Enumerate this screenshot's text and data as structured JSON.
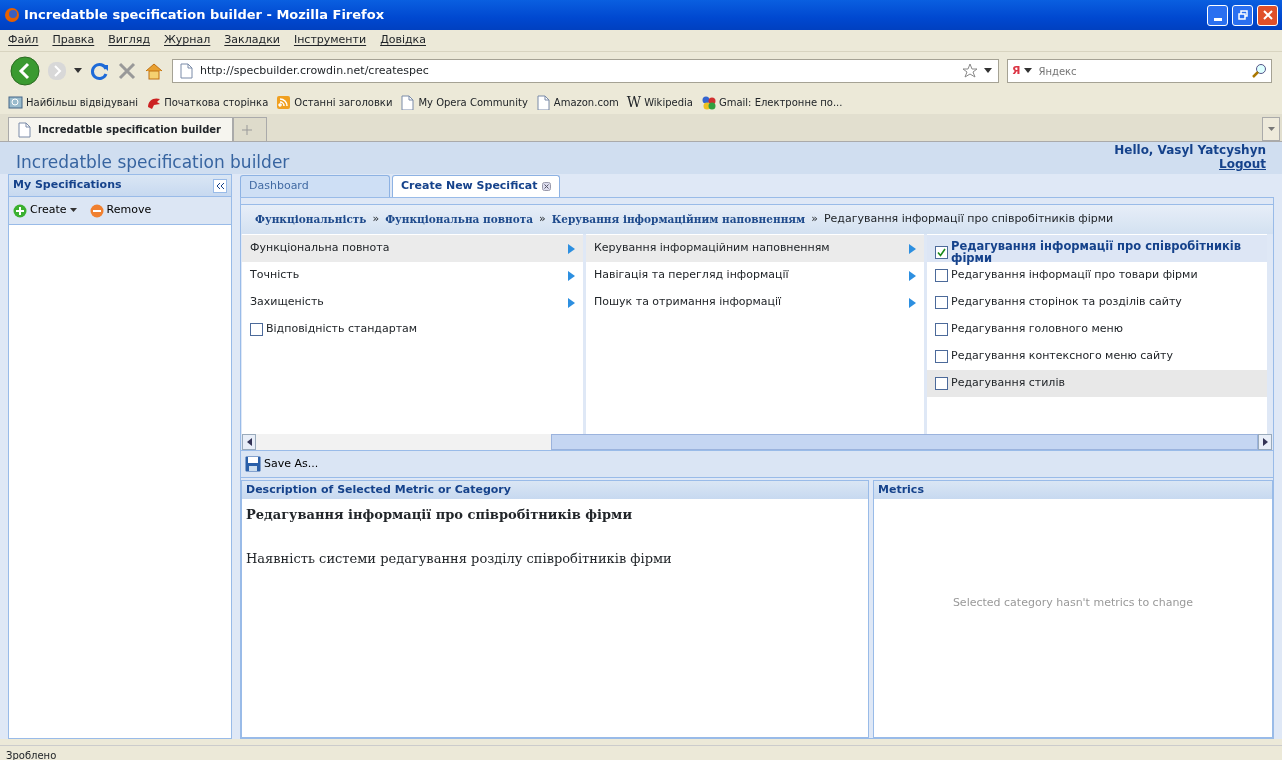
{
  "window": {
    "title": "Incredatble specification builder - Mozilla Firefox"
  },
  "menu": [
    "Файл",
    "Правка",
    "Вигляд",
    "Журнал",
    "Закладки",
    "Інструменти",
    "Довідка"
  ],
  "toolbar": {
    "url": "http://specbuilder.crowdin.net/createspec",
    "search_engine": "Я",
    "search_placeholder": "Яндекс"
  },
  "bookmarks": [
    {
      "label": "Найбільш відвідувані",
      "kind": "search"
    },
    {
      "label": "Початкова сторінка",
      "kind": "bird"
    },
    {
      "label": "Останні заголовки",
      "kind": "rss"
    },
    {
      "label": "My Opera Community",
      "kind": "page"
    },
    {
      "label": "Amazon.com",
      "kind": "page"
    },
    {
      "label": "Wikipedia",
      "kind": "wiki",
      "glyph": "W"
    },
    {
      "label": "Gmail: Електронне по...",
      "kind": "google"
    }
  ],
  "browser_tabs": [
    {
      "label": "Incredatble specification builder",
      "selected": true
    }
  ],
  "app": {
    "title": "Incredatble specification builder",
    "greeting": "Hello, Vasyl Yatcyshyn",
    "logout": "Logout"
  },
  "sidebar": {
    "title": "My Specifications",
    "actions": [
      {
        "label": "Create",
        "kind": "create"
      },
      {
        "label": "Remove",
        "kind": "remove"
      }
    ]
  },
  "tabs": [
    {
      "label": "Dashboard",
      "selected": false,
      "closable": false
    },
    {
      "label": "Create New Specificat",
      "selected": true,
      "closable": true
    }
  ],
  "breadcrumb": {
    "separator": "»",
    "links": [
      "Функціональність",
      "Функціональна повнота",
      "Керування інформаційним наповненням"
    ],
    "current": "Редагування інформації про співробітників фірми"
  },
  "columns": [
    {
      "items": [
        {
          "label": "Функціональна повнота",
          "kind": "branch",
          "selected": true
        },
        {
          "label": "Точність",
          "kind": "branch",
          "selected": false
        },
        {
          "label": "Захищеність",
          "kind": "branch",
          "selected": false
        },
        {
          "label": "Відповідність стандартам",
          "kind": "leaf",
          "checked": false,
          "selected": false
        }
      ]
    },
    {
      "items": [
        {
          "label": "Керування інформаційним наповненням",
          "kind": "branch",
          "selected": true
        },
        {
          "label": "Навігація та перегляд інформації",
          "kind": "branch",
          "selected": false
        },
        {
          "label": "Пошук та отримання інформації",
          "kind": "branch",
          "selected": false
        }
      ]
    },
    {
      "items": [
        {
          "label": "Редагування інформації про співробітників фірми",
          "kind": "leaf",
          "checked": true,
          "selected": true
        },
        {
          "label": "Редагування інформації про товари фірми",
          "kind": "leaf",
          "checked": false,
          "selected": false
        },
        {
          "label": "Редагування сторінок та розділів сайту",
          "kind": "leaf",
          "checked": false,
          "selected": false
        },
        {
          "label": "Редагування головного меню",
          "kind": "leaf",
          "checked": false,
          "selected": false
        },
        {
          "label": "Редагування контексного меню сайту",
          "kind": "leaf",
          "checked": false,
          "selected": false
        },
        {
          "label": "Редагування стилів",
          "kind": "leaf",
          "checked": false,
          "selected": false,
          "hovered": true
        }
      ]
    }
  ],
  "save_button": "Save As...",
  "description": {
    "heading": "Description of Selected Metric or Category",
    "title": "Редагування інформації про співробітників фірми",
    "text": "Наявність системи редагування розділу співробітників фірми"
  },
  "metrics": {
    "heading": "Metrics",
    "empty_text": "Selected category hasn't metrics to change"
  },
  "status_bar": "Зроблено"
}
